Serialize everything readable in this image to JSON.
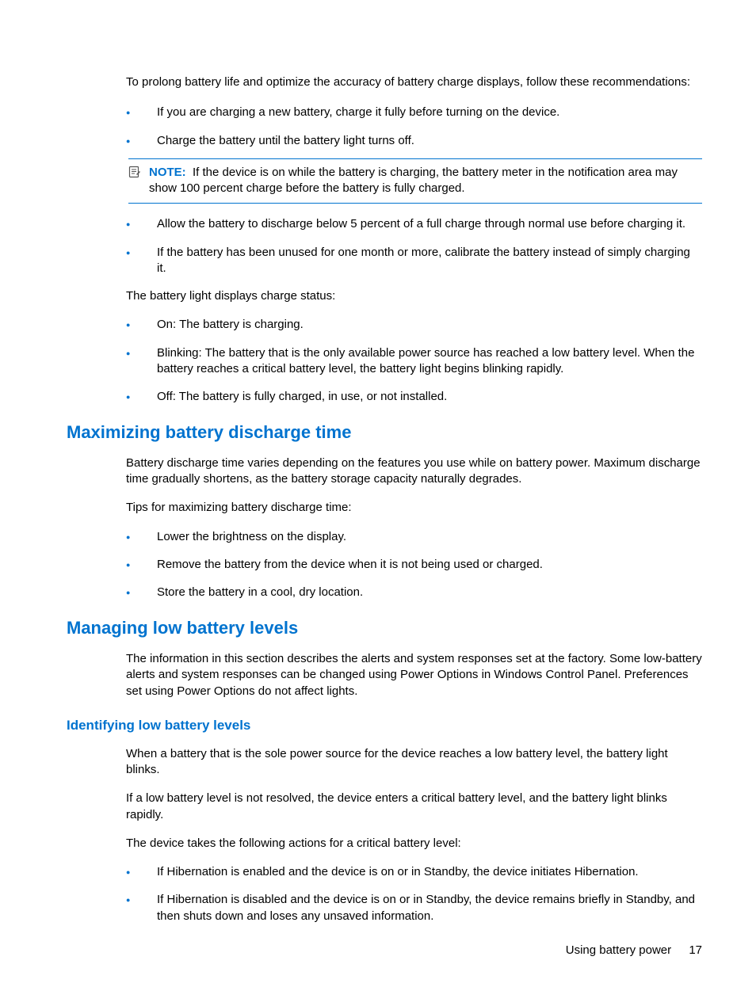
{
  "intro": "To prolong battery life and optimize the accuracy of battery charge displays, follow these recommendations:",
  "list1": {
    "i0": "If you are charging a new battery, charge it fully before turning on the device.",
    "i1": "Charge the battery until the battery light turns off."
  },
  "note": {
    "label": "NOTE:",
    "body": "If the device is on while the battery is charging, the battery meter in the notification area may show 100 percent charge before the battery is fully charged."
  },
  "list2": {
    "i0": "Allow the battery to discharge below 5 percent of a full charge through normal use before charging it.",
    "i1": "If the battery has been unused for one month or more, calibrate the battery instead of simply charging it."
  },
  "para2": "The battery light displays charge status:",
  "list3": {
    "i0": "On: The battery is charging.",
    "i1": "Blinking: The battery that is the only available power source has reached a low battery level. When the battery reaches a critical battery level, the battery light begins blinking rapidly.",
    "i2": "Off: The battery is fully charged, in use, or not installed."
  },
  "h2_a": "Maximizing battery discharge time",
  "para_a1": "Battery discharge time varies depending on the features you use while on battery power. Maximum discharge time gradually shortens, as the battery storage capacity naturally degrades.",
  "para_a2": "Tips for maximizing battery discharge time:",
  "list4": {
    "i0": "Lower the brightness on the display.",
    "i1": "Remove the battery from the device when it is not being used or charged.",
    "i2": "Store the battery in a cool, dry location."
  },
  "h2_b": "Managing low battery levels",
  "para_b1": "The information in this section describes the alerts and system responses set at the factory. Some low-battery alerts and system responses can be changed using Power Options in Windows Control Panel. Preferences set using Power Options do not affect lights.",
  "h3_b": "Identifying low battery levels",
  "para_b2": "When a battery that is the sole power source for the device reaches a low battery level, the battery light blinks.",
  "para_b3": "If a low battery level is not resolved, the device enters a critical battery level, and the battery light blinks rapidly.",
  "para_b4": "The device takes the following actions for a critical battery level:",
  "list5": {
    "i0": "If Hibernation is enabled and the device is on or in Standby, the device initiates Hibernation.",
    "i1": "If Hibernation is disabled and the device is on or in Standby, the device remains briefly in Standby, and then shuts down and loses any unsaved information."
  },
  "footer": {
    "section": "Using battery power",
    "page": "17"
  }
}
